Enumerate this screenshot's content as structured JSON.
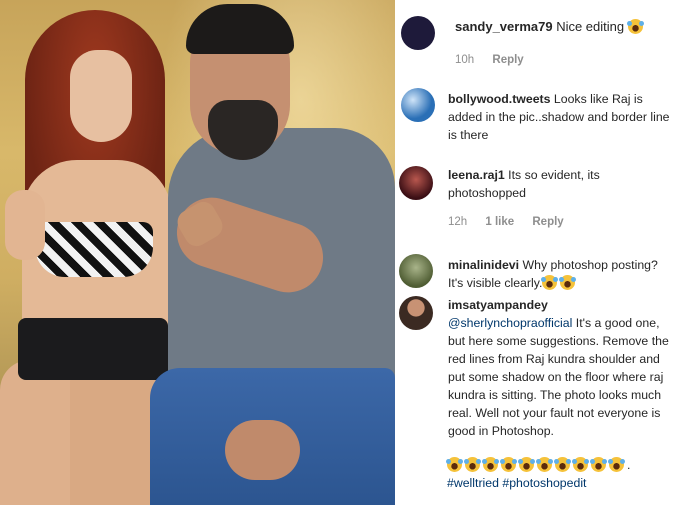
{
  "comments": [
    {
      "username": "sandy_verma79",
      "text": " Nice editing",
      "emoji_count": 1,
      "time": "10h",
      "reply_label": "Reply",
      "avatar_color": "#1e1a3a"
    },
    {
      "username": "bollywood.tweets",
      "text": " Looks like Raj is added in the pic..shadow and border line is there",
      "avatar_color": "#2a6fb6"
    },
    {
      "username": "leena.raj1",
      "text": " Its so evident, its photoshopped",
      "time": "12h",
      "likes": "1 like",
      "reply_label": "Reply",
      "avatar_color": "#6a1a22"
    },
    {
      "username": "minalinidevi",
      "text": " Why photoshop posting? It's visible clearly.",
      "emoji_count": 2,
      "avatar_color": "#6b7a4a"
    },
    {
      "username": "imsatyampandey",
      "mention": "@sherlynchopraofficial",
      "text": " It's a good one, but here some suggestions. Remove the red lines from Raj kundra shoulder and put some shadow on the floor where raj kundra is sitting. The photo looks much real. Well not your fault not everyone is good in Photoshop.",
      "emoji_count": 10,
      "emoji_tail": ".",
      "hashtags": "#welltried #photoshopedit",
      "avatar_color": "#3b2a22"
    }
  ],
  "icons": {
    "emoji": "face-with-tears-of-joy-icon"
  }
}
